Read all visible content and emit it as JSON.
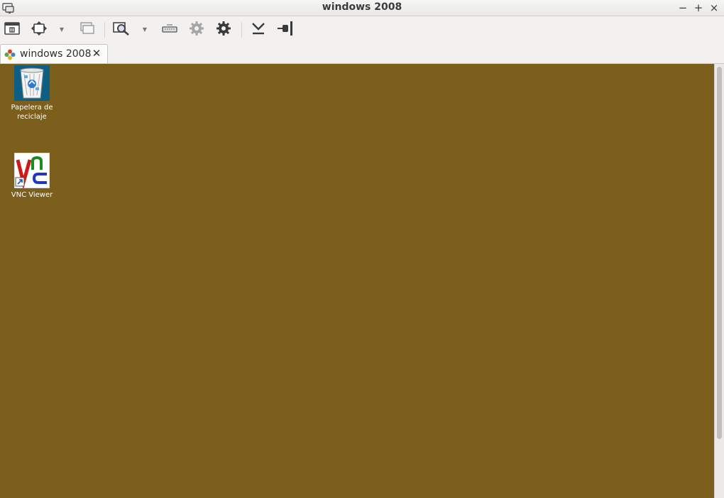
{
  "window": {
    "title": "windows 2008",
    "controls": {
      "minimize": "−",
      "maximize": "+",
      "close": "×"
    }
  },
  "toolbar": {
    "buttons": [
      {
        "name": "toggle-fullscreen",
        "icon": "window-title-icon"
      },
      {
        "name": "scaling-mode",
        "icon": "fit-window-arrows-icon",
        "dropdown": true
      },
      {
        "name": "grab-keyboard",
        "icon": "overlapping-windows-icon"
      },
      {
        "name": "screenshot-zoom",
        "icon": "magnifier-icon",
        "dropdown": true
      },
      {
        "name": "send-keys",
        "icon": "keyboard-icon"
      },
      {
        "name": "preferences-disabled",
        "icon": "gear-grey-icon"
      },
      {
        "name": "preferences",
        "icon": "gear-icon"
      },
      {
        "name": "minimize-window",
        "icon": "download-arrow-icon"
      },
      {
        "name": "disconnect",
        "icon": "plug-icon"
      }
    ]
  },
  "tab": {
    "label": "windows 2008",
    "close": "✕"
  },
  "desktop": {
    "background": "#7c5f1d",
    "icons": [
      {
        "label": "Papelera de reciclaje",
        "icon": "recycle-bin-icon"
      },
      {
        "label": "VNC Viewer",
        "icon": "vnc-viewer-icon"
      }
    ]
  }
}
